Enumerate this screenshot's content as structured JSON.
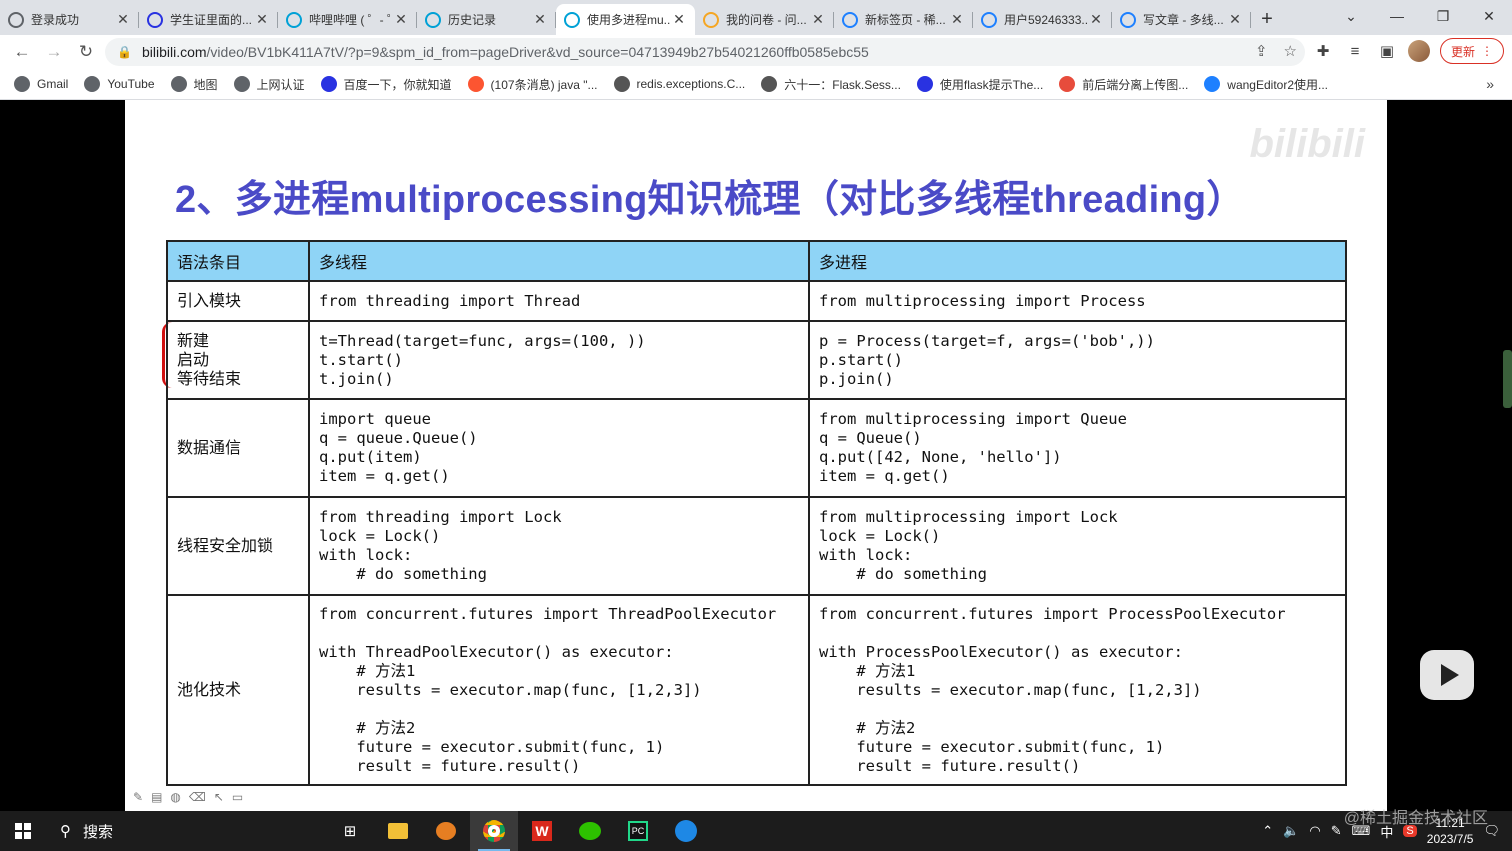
{
  "browser": {
    "tabs": [
      {
        "label": "登录成功",
        "icon": "globe-icon",
        "color": "#5f6368"
      },
      {
        "label": "学生证里面的...",
        "icon": "paw-icon",
        "color": "#2932e1"
      },
      {
        "label": "哔哩哔哩 ( ゜- ゜)",
        "icon": "bilibili-icon",
        "color": "#00a1d6"
      },
      {
        "label": "历史记录",
        "icon": "bilibili-icon",
        "color": "#00a1d6"
      },
      {
        "label": "使用多进程mu...",
        "icon": "bilibili-icon",
        "color": "#00a1d6",
        "active": true
      },
      {
        "label": "我的问卷 - 问...",
        "icon": "star-icon",
        "color": "#f5a623"
      },
      {
        "label": "新标签页 - 稀...",
        "icon": "juejin-icon",
        "color": "#1e80ff"
      },
      {
        "label": "用户59246333...",
        "icon": "juejin-icon",
        "color": "#1e80ff"
      },
      {
        "label": "写文章 - 多线...",
        "icon": "juejin-icon",
        "color": "#1e80ff"
      }
    ],
    "url_host": "bilibili.com",
    "url_rest": "/video/BV1bK411A7tV/?p=9&spm_id_from=pageDriver&vd_source=04713949b27b54021260ffb0585ebc55",
    "update_label": "更新",
    "bookmarks": [
      {
        "label": "Gmail",
        "color": "#5f6368"
      },
      {
        "label": "YouTube",
        "color": "#5f6368"
      },
      {
        "label": "地图",
        "color": "#5f6368"
      },
      {
        "label": "上网认证",
        "color": "#5f6368"
      },
      {
        "label": "百度一下，你就知道",
        "color": "#2932e1"
      },
      {
        "label": "(107条消息) java \"...",
        "color": "#fc5531"
      },
      {
        "label": "redis.exceptions.C...",
        "color": "#555555"
      },
      {
        "label": "六十一：Flask.Sess...",
        "color": "#555555"
      },
      {
        "label": "使用flask提示The...",
        "color": "#2932e1"
      },
      {
        "label": "前后端分离上传图...",
        "color": "#e74c3c"
      },
      {
        "label": "wangEditor2使用...",
        "color": "#1e80ff"
      }
    ]
  },
  "slide": {
    "title": "2、多进程multiprocessing知识梳理（对比多线程threading）",
    "watermark": "bilibili",
    "headers": [
      "语法条目",
      "多线程",
      "多进程"
    ],
    "rows": [
      {
        "label": "引入模块",
        "thread": "from threading import Thread",
        "process": "from multiprocessing import Process"
      },
      {
        "label": "新建\n启动\n等待结束",
        "thread": "t=Thread(target=func, args=(100, ))\nt.start()\nt.join()",
        "process": "p = Process(target=f, args=('bob',))\np.start()\np.join()"
      },
      {
        "label": "数据通信",
        "thread": "import queue\nq = queue.Queue()\nq.put(item)\nitem = q.get()",
        "process": "from multiprocessing import Queue\nq = Queue()\nq.put([42, None, 'hello'])\nitem = q.get()"
      },
      {
        "label": "线程安全加锁",
        "thread": "from threading import Lock\nlock = Lock()\nwith lock:\n    # do something",
        "process": "from multiprocessing import Lock\nlock = Lock()\nwith lock:\n    # do something"
      },
      {
        "label": "池化技术",
        "thread": "from concurrent.futures import ThreadPoolExecutor\n\nwith ThreadPoolExecutor() as executor:\n    # 方法1\n    results = executor.map(func, [1,2,3])\n\n    # 方法2\n    future = executor.submit(func, 1)\n    result = future.result()",
        "process": "from concurrent.futures import ProcessPoolExecutor\n\nwith ProcessPoolExecutor() as executor:\n    # 方法1\n    results = executor.map(func, [1,2,3])\n\n    # 方法2\n    future = executor.submit(func, 1)\n    result = future.result()"
      }
    ]
  },
  "taskbar": {
    "search_label": "搜索",
    "ime": "中",
    "time": "11:21",
    "date": "2023/7/5"
  },
  "overlay_watermark": "@稀土掘金技术社区"
}
